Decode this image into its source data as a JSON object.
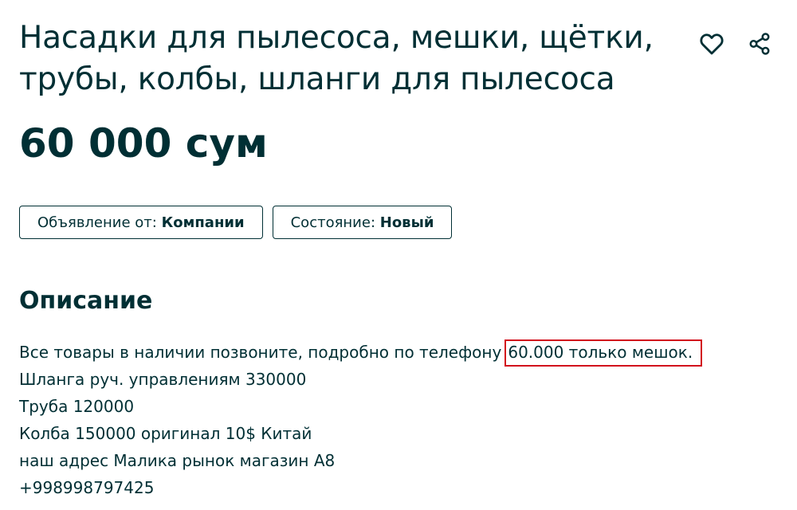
{
  "listing": {
    "title": "Насадки для пылесоса, мешки, щётки, трубы, колбы, шланги для пылесоса",
    "price": "60 000 сум"
  },
  "actions": {
    "favorite_icon": "heart-icon",
    "share_icon": "share-icon"
  },
  "tags": [
    {
      "label": "Объявление от: ",
      "value": "Компании"
    },
    {
      "label": "Состояние: ",
      "value": "Новый"
    }
  ],
  "description": {
    "heading": "Описание",
    "line1_text": "Все товары в наличии позвоните, подробно по телефону",
    "line1_highlight": "60.000 только мешок.",
    "lines": [
      "Шланга руч. управлениям 330000",
      "Труба 120000",
      "Колба 150000 оригинал 10$ Китай",
      "наш адрес Малика рынок магазин А8",
      "+998998797425"
    ]
  },
  "colors": {
    "text": "#002f34",
    "highlight_border": "#d20f1c",
    "background": "#ffffff"
  }
}
